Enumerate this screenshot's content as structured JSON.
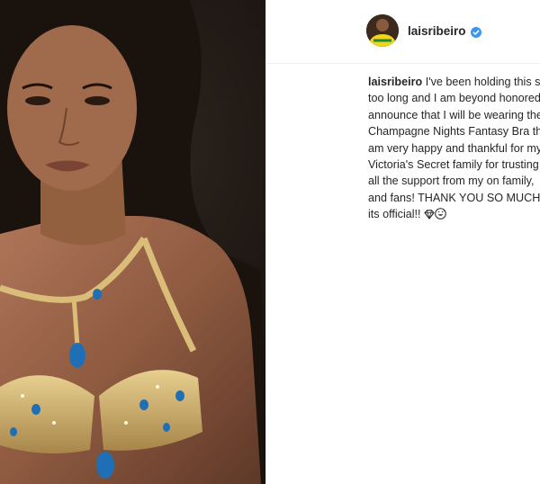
{
  "post": {
    "author": {
      "username": "laisribeiro",
      "verified": true,
      "avatar_icon": "profile-avatar"
    },
    "photo": {
      "icon": "post-photo"
    },
    "caption": {
      "username": "laisribeiro",
      "lines": [
        " I've been holding this se",
        "too long and I am beyond honored",
        "announce that I will be wearing the",
        "Champagne Nights Fantasy Bra thi",
        "am very happy and thankful for my",
        "Victoria's Secret family for trusting",
        "all the support from my on family,",
        "and fans! THANK YOU SO MUCH!!!",
        "its official!! "
      ],
      "emojis": [
        "gem-icon",
        "grin-sweat-icon"
      ]
    }
  },
  "colors": {
    "text": "#262626",
    "verified_badge": "#3897f0",
    "divider": "#efefef"
  }
}
